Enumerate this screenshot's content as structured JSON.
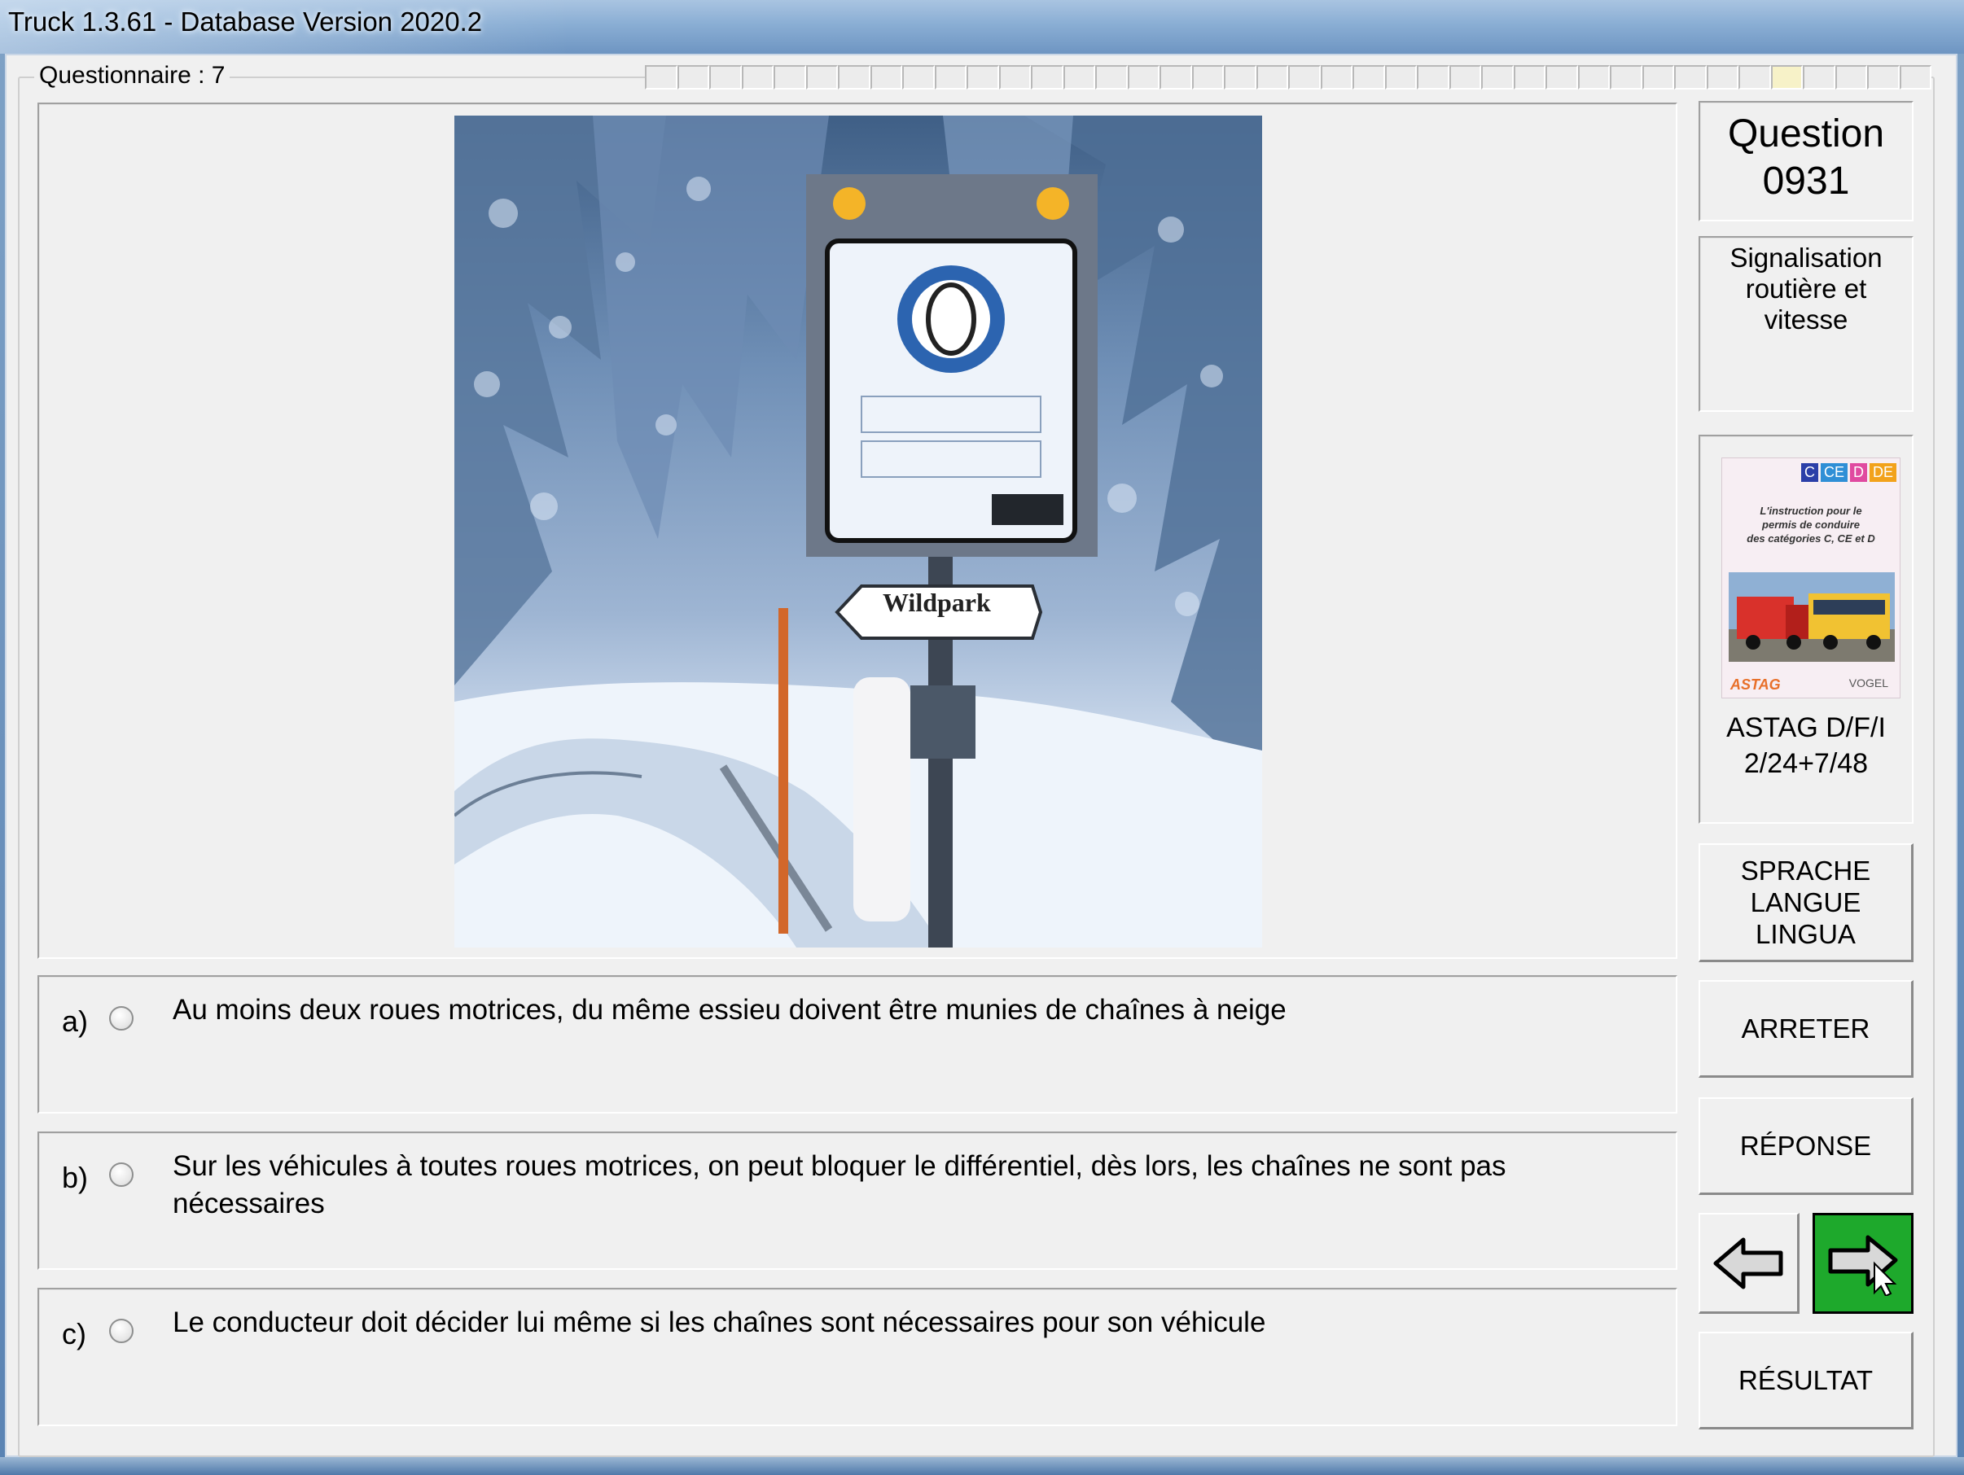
{
  "window": {
    "title": "Truck 1.3.61 - Database Version 2020.2"
  },
  "questionnaire": {
    "label": "Questionnaire : 7",
    "progress_total": 40,
    "progress_current": 36
  },
  "question": {
    "heading": "Question",
    "number": "0931",
    "category_line1": "Signalisation",
    "category_line2": "routière et vitesse"
  },
  "image": {
    "sign_text": "Wildpark"
  },
  "book": {
    "badges": [
      "C",
      "CE",
      "D",
      "DE"
    ],
    "title_line1": "L'instruction pour le",
    "title_line2": "permis de conduire",
    "title_line3": "des catégories C, CE et D",
    "publisher_left": "ASTAG",
    "publisher_right": "VOGEL",
    "caption_line1": "ASTAG D/F/I",
    "caption_line2": "2/24+7/48"
  },
  "answers": [
    {
      "letter": "a)",
      "text": "Au moins deux roues motrices, du même essieu doivent être munies de chaînes à neige",
      "selected": false
    },
    {
      "letter": "b)",
      "text": "Sur les véhicules à toutes roues motrices, on peut bloquer le différentiel, dès lors, les chaînes ne sont pas nécessaires",
      "selected": false
    },
    {
      "letter": "c)",
      "text": "Le conducteur doit décider lui même si les chaînes sont nécessaires pour son véhicule",
      "selected": false
    }
  ],
  "buttons": {
    "language_line1": "SPRACHE",
    "language_line2": "LANGUE",
    "language_line3": "LINGUA",
    "stop": "ARRETER",
    "answer": "RÉPONSE",
    "result": "RÉSULTAT",
    "prev_icon": "arrow-left-icon",
    "next_icon": "arrow-right-icon"
  },
  "colors": {
    "next_button": "#1ea92c",
    "progress_done": "#f7f2c8"
  }
}
